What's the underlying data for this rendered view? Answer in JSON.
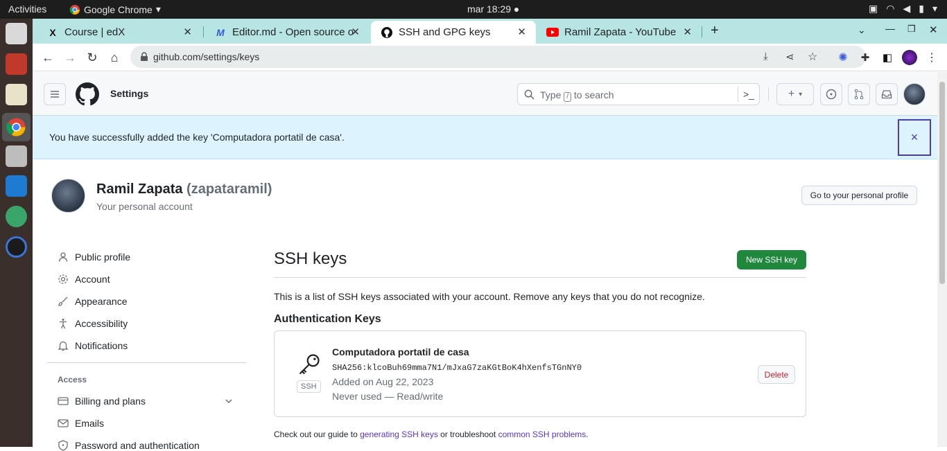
{
  "os": {
    "activities": "Activities",
    "app_name": "Google Chrome",
    "clock": "mar 18:29"
  },
  "browser": {
    "tabs": [
      {
        "title": "Course | edX",
        "favicon": "edx-icon"
      },
      {
        "title": "Editor.md - Open source o",
        "favicon": "editormd-icon"
      },
      {
        "title": "SSH and GPG keys",
        "favicon": "github-icon"
      },
      {
        "title": "Ramil Zapata - YouTube",
        "favicon": "youtube-icon"
      }
    ],
    "url": "github.com/settings/keys"
  },
  "header": {
    "title": "Settings",
    "search_pre": "Type",
    "search_slash": "/",
    "search_post": "to search"
  },
  "flash": {
    "message": "You have successfully added the key 'Computadora portatil de casa'.",
    "close": "×"
  },
  "profile": {
    "name": "Ramil Zapata",
    "login": "(zapataramil)",
    "subtitle": "Your personal account",
    "go_profile": "Go to your personal profile"
  },
  "sidebar": {
    "items": [
      {
        "label": "Public profile",
        "icon": "person-icon"
      },
      {
        "label": "Account",
        "icon": "gear-icon"
      },
      {
        "label": "Appearance",
        "icon": "paintbrush-icon"
      },
      {
        "label": "Accessibility",
        "icon": "accessibility-icon"
      },
      {
        "label": "Notifications",
        "icon": "bell-icon"
      }
    ],
    "access_header": "Access",
    "access_items": [
      {
        "label": "Billing and plans",
        "icon": "credit-card-icon"
      },
      {
        "label": "Emails",
        "icon": "mail-icon"
      },
      {
        "label": "Password and authentication",
        "icon": "shield-icon"
      }
    ]
  },
  "main": {
    "title": "SSH keys",
    "new_key": "New SSH key",
    "description": "This is a list of SSH keys associated with your account. Remove any keys that you do not recognize.",
    "auth_header": "Authentication Keys",
    "key": {
      "title": "Computadora portatil de casa",
      "fingerprint": "SHA256:klcoBuh69mma7N1/mJxaG7zaKGtBoK4hXenfsTGnNY0",
      "added": "Added on Aug 22, 2023",
      "used": "Never used — Read/write",
      "badge": "SSH",
      "delete": "Delete"
    },
    "guide_pre": "Check out our guide to",
    "guide_link1": "generating SSH keys",
    "guide_mid": "or troubleshoot",
    "guide_link2": "common SSH problems",
    "guide_post": "."
  },
  "colors": {
    "tabstrip": "#b7e5e3",
    "flash_bg": "#ddf4ff",
    "primary_button": "#1f883d",
    "danger": "#cf222e",
    "link": "#5a32d6"
  }
}
